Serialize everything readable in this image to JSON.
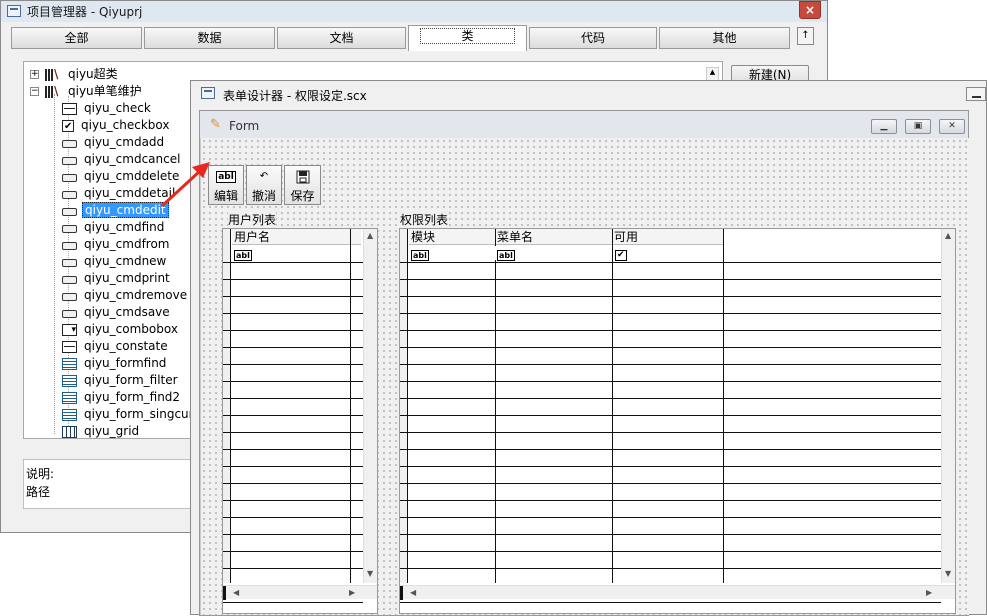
{
  "project_manager": {
    "title": "项目管理器 - Qiyuprj",
    "close_glyph": "×",
    "tabs": [
      "全部",
      "数据",
      "文档",
      "类",
      "代码",
      "其他"
    ],
    "active_tab": "类",
    "collapse_glyph": "↑",
    "new_button": "新建(N)",
    "tree": {
      "groups": [
        {
          "expander": "+",
          "label": "qiyu超类"
        },
        {
          "expander": "−",
          "label": "qiyu单笔维护"
        }
      ],
      "items": [
        {
          "label": "qiyu_check",
          "icon": "command-icon"
        },
        {
          "label": "qiyu_checkbox",
          "icon": "checkbox-icon"
        },
        {
          "label": "qiyu_cmdadd",
          "icon": "button-icon"
        },
        {
          "label": "qiyu_cmdcancel",
          "icon": "button-icon"
        },
        {
          "label": "qiyu_cmddelete",
          "icon": "button-icon"
        },
        {
          "label": "qiyu_cmddetail",
          "icon": "button-icon"
        },
        {
          "label": "qiyu_cmdedit",
          "icon": "button-icon",
          "selected": true
        },
        {
          "label": "qiyu_cmdfind",
          "icon": "button-icon"
        },
        {
          "label": "qiyu_cmdfrom",
          "icon": "button-icon"
        },
        {
          "label": "qiyu_cmdnew",
          "icon": "button-icon"
        },
        {
          "label": "qiyu_cmdprint",
          "icon": "button-icon"
        },
        {
          "label": "qiyu_cmdremove",
          "icon": "button-icon"
        },
        {
          "label": "qiyu_cmdsave",
          "icon": "button-icon"
        },
        {
          "label": "qiyu_combobox",
          "icon": "combobox-icon"
        },
        {
          "label": "qiyu_constate",
          "icon": "constate-icon"
        },
        {
          "label": "qiyu_formfind",
          "icon": "form-icon"
        },
        {
          "label": "qiyu_form_filter",
          "icon": "form-icon"
        },
        {
          "label": "qiyu_form_find2",
          "icon": "form-icon"
        },
        {
          "label": "qiyu_form_singcurs",
          "icon": "form-icon"
        },
        {
          "label": "qiyu_grid",
          "icon": "grid-icon"
        }
      ]
    },
    "description_label": "说明:",
    "path_label": "路径"
  },
  "form_designer": {
    "title": "表单设计器 - 权限设定.scx",
    "form": {
      "title": "Form",
      "buttons": [
        {
          "label": "编辑",
          "icon": "text-box-icon",
          "glyph": "abl"
        },
        {
          "label": "撤消",
          "icon": "undo-icon",
          "glyph": "↶"
        },
        {
          "label": "保存",
          "icon": "save-icon",
          "glyph": "💾"
        }
      ],
      "user_list": {
        "label": "用户列表",
        "columns": [
          "用户名"
        ],
        "first_row_glyphs": [
          "abl"
        ]
      },
      "permission_list": {
        "label": "权限列表",
        "columns": [
          "模块",
          "菜单名",
          "可用"
        ],
        "first_row_glyphs": [
          "abl",
          "abl",
          "✔"
        ]
      }
    }
  },
  "colors": {
    "selection": "#3399ff",
    "arrow": "#e8281e",
    "close_button": "#c64b3f"
  }
}
